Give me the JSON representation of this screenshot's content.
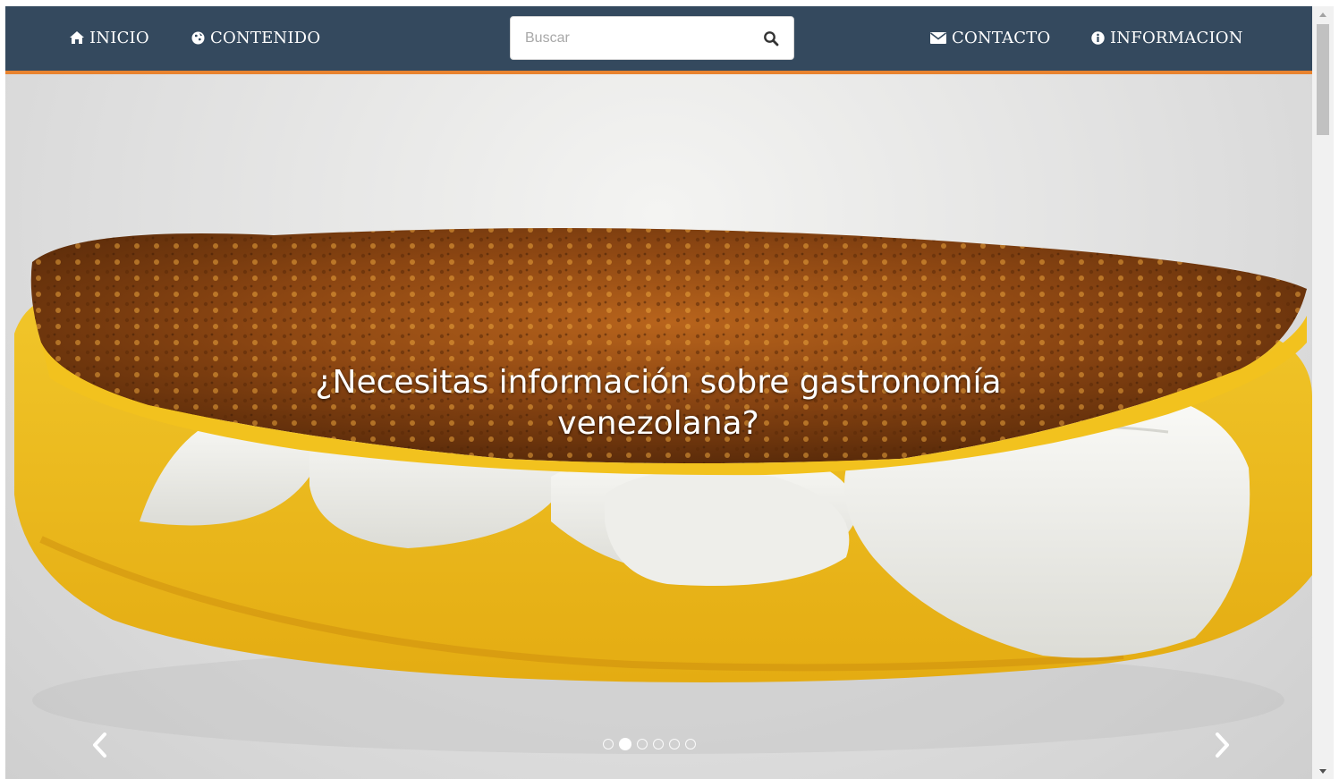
{
  "nav": {
    "inicio": "INICIO",
    "contenido": "CONTENIDO",
    "contacto": "CONTACTO",
    "informacion": "INFORMACION",
    "inicio_icon": "home-icon",
    "contenido_icon": "globe-icon",
    "contacto_icon": "envelope-icon",
    "informacion_icon": "info-circle-icon"
  },
  "search": {
    "placeholder": "Buscar",
    "value": "",
    "icon": "search-icon"
  },
  "hero": {
    "caption": "¿Necesitas información sobre gastronomía venezolana?",
    "image": "cachapa-con-queso-photo",
    "prev_icon": "chevron-left-icon",
    "next_icon": "chevron-right-icon",
    "slide_count": 6,
    "active_slide": 2
  },
  "colors": {
    "navbar": "#34495e",
    "navbar_accent": "#e8832f",
    "nav_text": "#ffffff"
  }
}
